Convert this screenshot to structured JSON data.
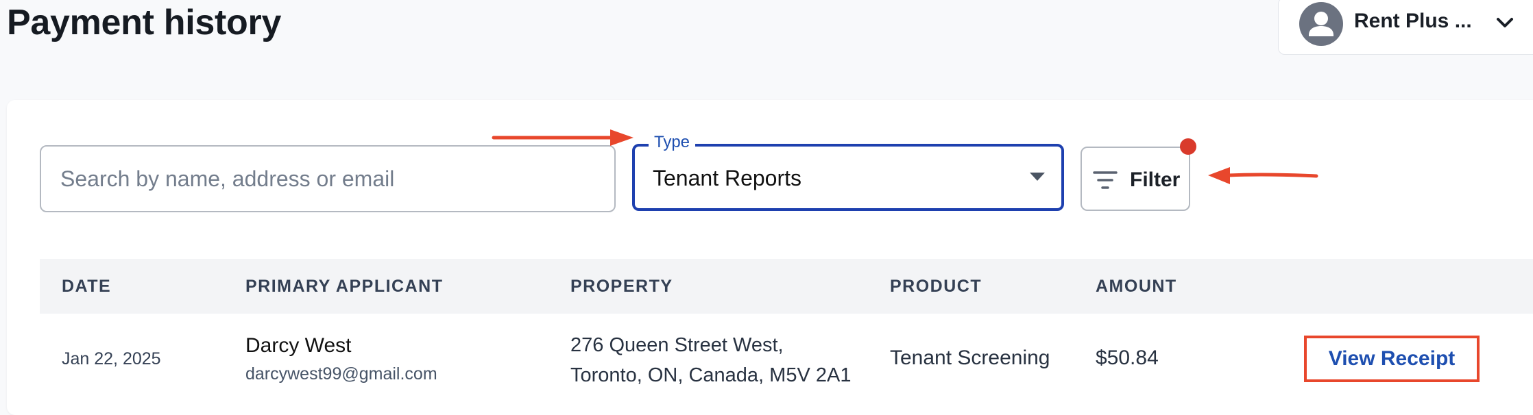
{
  "page": {
    "title": "Payment history"
  },
  "account": {
    "name": "Rent Plus ..."
  },
  "search": {
    "placeholder": "Search by name, address or email",
    "value": ""
  },
  "type_select": {
    "label": "Type",
    "selected": "Tenant Reports"
  },
  "filter": {
    "label": "Filter",
    "has_active_indicator": true
  },
  "table": {
    "columns": [
      "DATE",
      "PRIMARY APPLICANT",
      "PROPERTY",
      "PRODUCT",
      "AMOUNT"
    ],
    "rows": [
      {
        "date": "Jan 22, 2025",
        "applicant_name": "Darcy West",
        "applicant_email": "darcywest99@gmail.com",
        "property_line1": "276 Queen Street West,",
        "property_line2": "Toronto, ON, Canada, M5V 2A1",
        "product": "Tenant Screening",
        "amount": "$50.84",
        "action": "View Receipt"
      }
    ]
  },
  "colors": {
    "accent": "#1e40af",
    "annotation": "#e8472c",
    "indicator": "#d93a2b",
    "avatar": "#6b7280"
  },
  "icons": {
    "avatar": "user-avatar-icon",
    "account_chevron": "chevron-down-icon",
    "type_caret": "caret-down-icon",
    "filter": "filter-lines-icon"
  }
}
